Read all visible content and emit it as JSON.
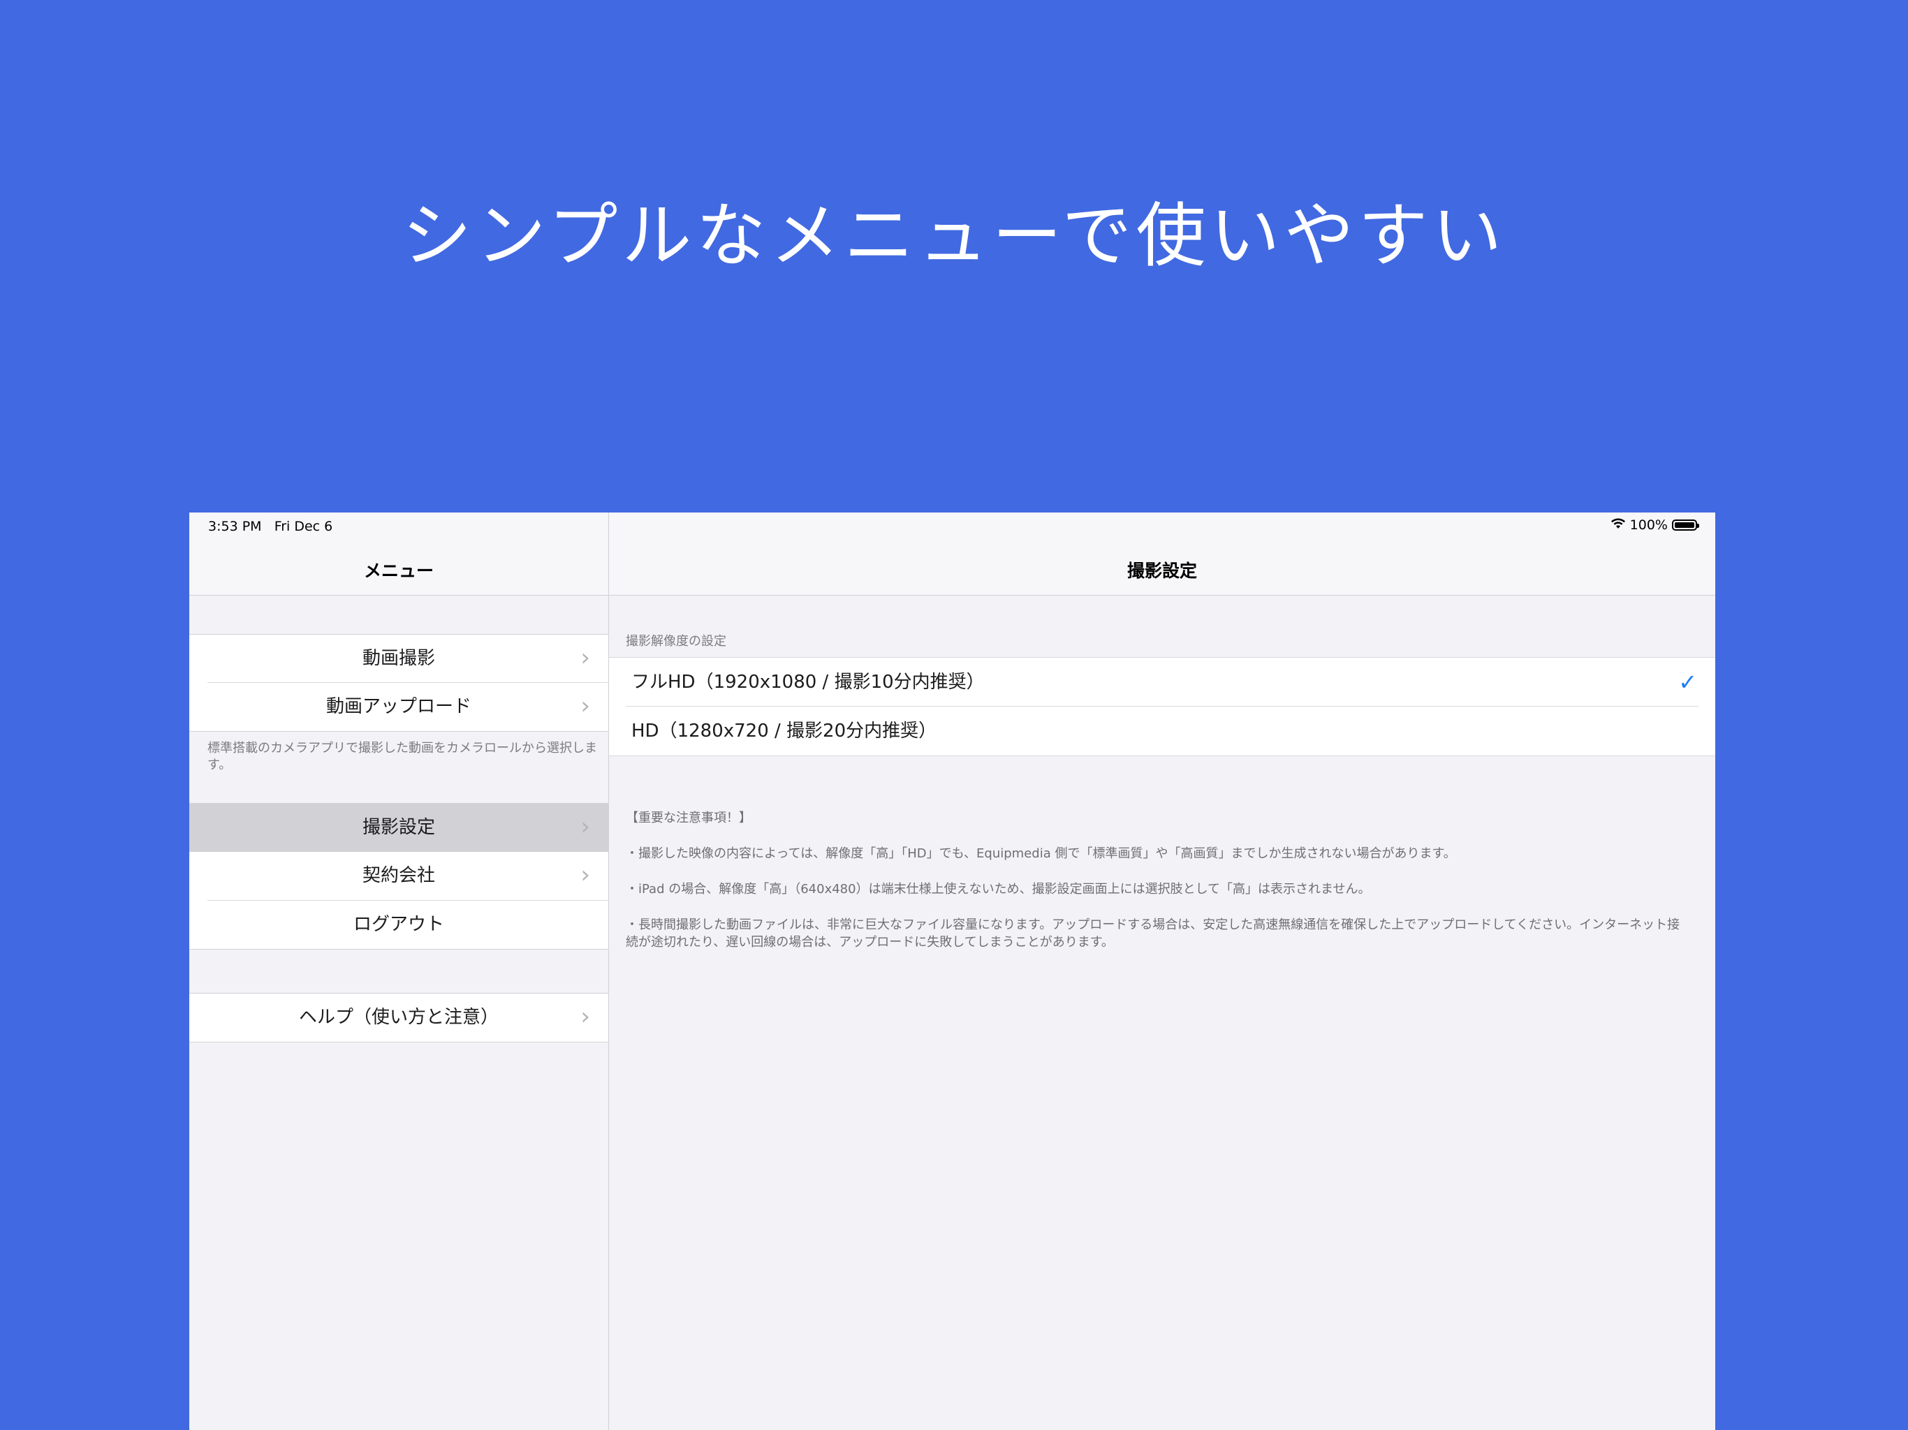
{
  "headline": "シンプルなメニューで使いやすい",
  "status_bar": {
    "time": "3:53 PM",
    "date": "Fri Dec 6",
    "battery": "100%",
    "wifi_icon": "wifi-icon",
    "battery_icon": "battery-icon"
  },
  "master": {
    "title": "メニュー",
    "group1": [
      {
        "label": "動画撮影"
      },
      {
        "label": "動画アップロード"
      }
    ],
    "group1_footer": "標準搭載のカメラアプリで撮影した動画をカメラロールから選択します。",
    "group2": [
      {
        "label": "撮影設定",
        "selected": true
      },
      {
        "label": "契約会社"
      },
      {
        "label": "ログアウト"
      }
    ],
    "group3": [
      {
        "label": "ヘルプ（使い方と注意）"
      }
    ],
    "chevron": "›"
  },
  "detail": {
    "title": "撮影設定",
    "section_header": "撮影解像度の設定",
    "options": [
      {
        "label": "フルHD（1920x1080 / 撮影10分内推奨）",
        "checked": true
      },
      {
        "label": "HD（1280x720 / 撮影20分内推奨）",
        "checked": false
      }
    ],
    "checkmark": "✓",
    "notes_title": "【重要な注意事項！】",
    "notes": [
      "・撮影した映像の内容によっては、解像度「高」「HD」でも、Equipmedia 側で「標準画質」や「高画質」までしか生成されない場合があります。",
      "・iPad の場合、解像度「高」（640x480）は端末仕様上使えないため、撮影設定画面上には選択肢として「高」は表示されません。",
      "・長時間撮影した動画ファイルは、非常に巨大なファイル容量になります。アップロードする場合は、安定した高速無線通信を確保した上でアップロードしてください。インターネット接続が途切れたり、遅い回線の場合は、アップロードに失敗してしまうことがあります。"
    ]
  },
  "colors": {
    "background": "#4169E1",
    "accent": "#1A7CF5",
    "selected_row": "#D1D1D6"
  }
}
